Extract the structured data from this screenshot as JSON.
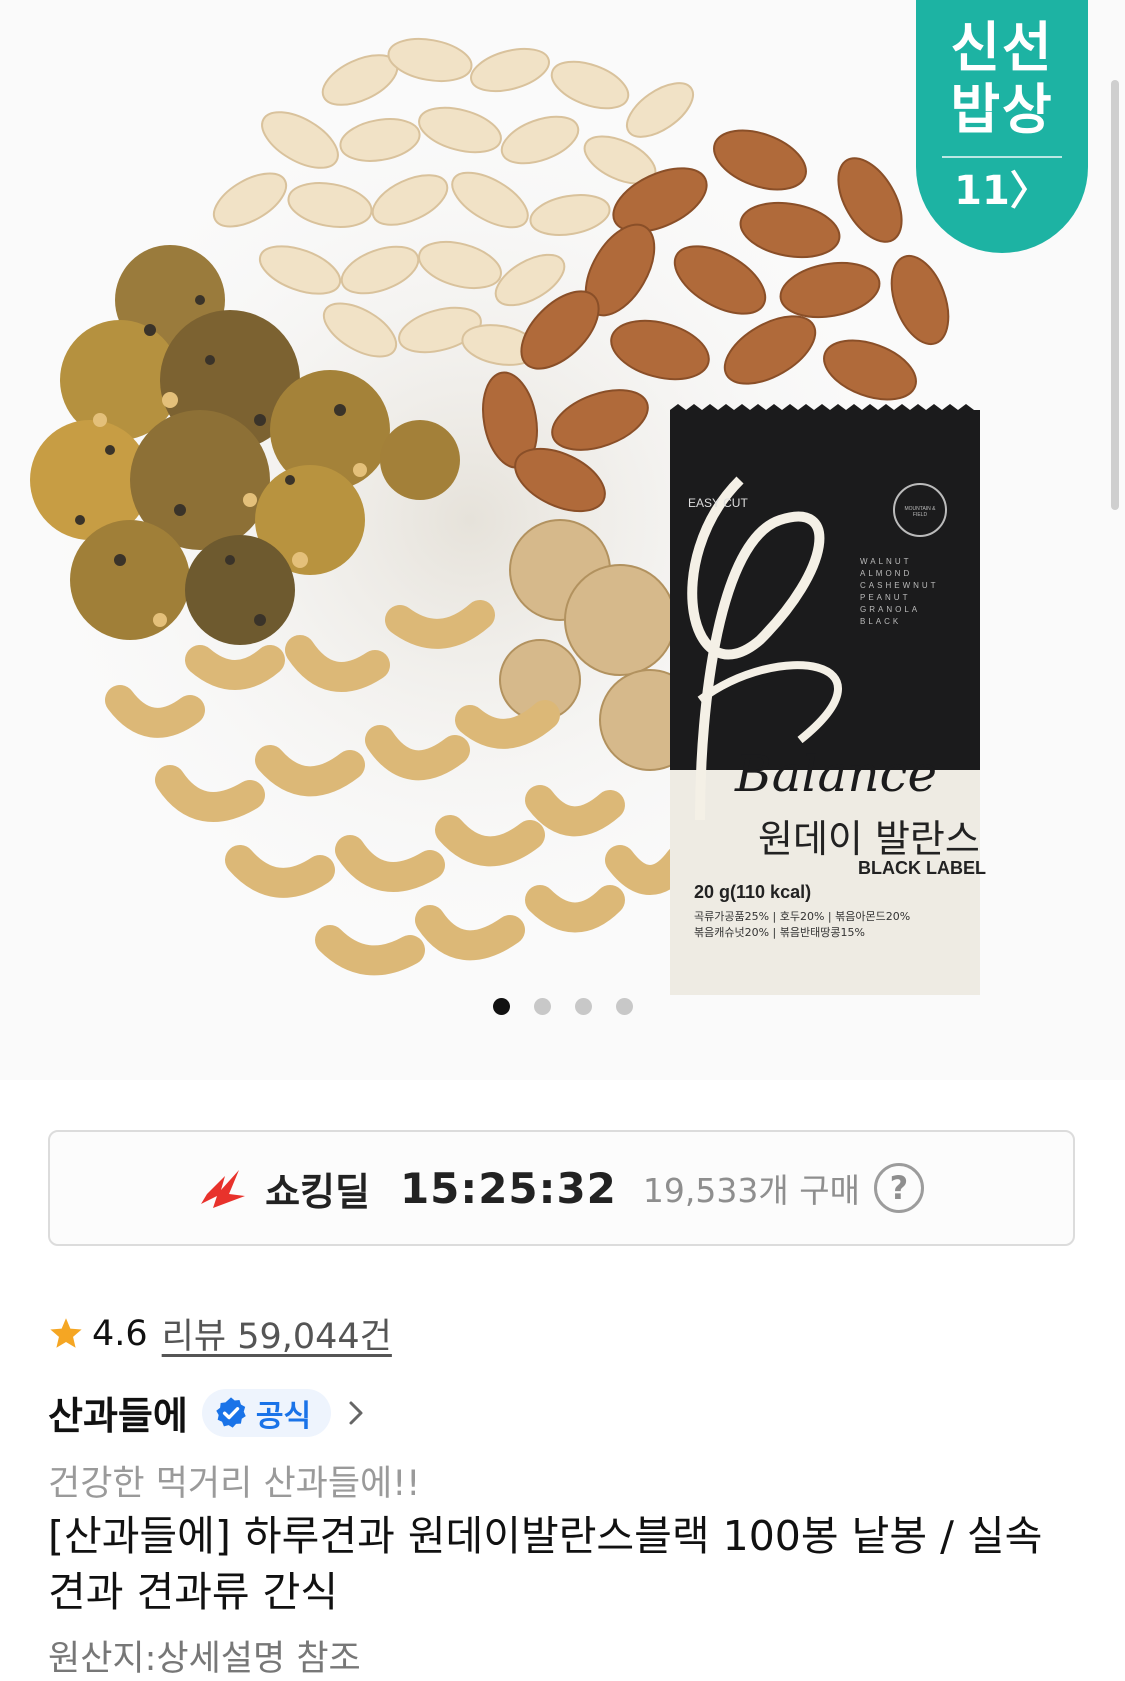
{
  "hero": {
    "badge": {
      "line1": "신선",
      "line2": "밥상",
      "logo": "11〉"
    },
    "package": {
      "easy_cut": "EASY CUT",
      "brand_script": "Balance",
      "name_ko": "원데이 발란스",
      "label": "BLACK LABEL",
      "nutrition": "20 g(110 kcal)",
      "ingredients_1": "곡류가공품25% | 호두20% | 볶음아몬드20%",
      "ingredients_2": "볶음캐슈넛20% | 볶음반태땅콩15%",
      "ingredient_list": [
        "WALNUT",
        "ALMOND",
        "CASHEWNUT",
        "PEANUT",
        "GRANOLA",
        "BLACK"
      ],
      "seal": "MOUNTAIN & FIELD"
    },
    "carousel": {
      "total": 4,
      "active": 1
    }
  },
  "deal": {
    "icon": "shocking-deal-flash-icon",
    "label": "쇼킹딜",
    "timer": "15:25:32",
    "purchase_count": "19,533개 구매",
    "help": "?"
  },
  "rating": {
    "score": "4.6",
    "reviews": "리뷰 59,044건",
    "star_color": "#f5a623"
  },
  "seller": {
    "name": "산과들에",
    "official_label": "공식",
    "official_color": "#1a73e8"
  },
  "product": {
    "tagline": "건강한 먹거리 산과들에!!",
    "title": "[산과들에] 하루견과 원데이발란스블랙 100봉 낱봉 / 실속 견과 견과류 간식",
    "origin": "원산지:상세설명 참조"
  },
  "colors": {
    "badge": "#1db3a3",
    "deal_flash": "#e8322c"
  }
}
